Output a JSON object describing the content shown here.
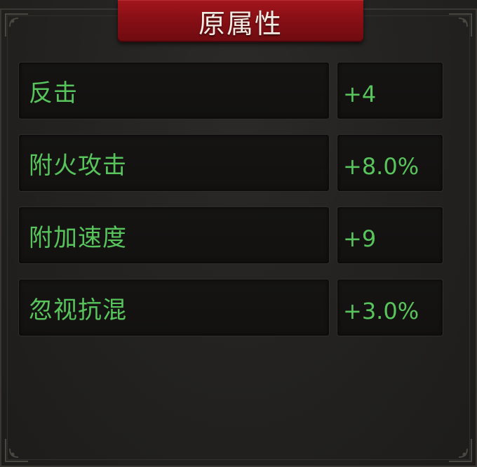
{
  "panel": {
    "title": "原属性",
    "attributes": [
      {
        "name": "反击",
        "value": "+4"
      },
      {
        "name": "附火攻击",
        "value": "+8.0%"
      },
      {
        "name": "附加速度",
        "value": "+9"
      },
      {
        "name": "忽视抗混",
        "value": "+3.0%"
      }
    ]
  },
  "colors": {
    "title_banner": "#8a1016",
    "attribute_text": "#58c45c",
    "cell_background": "#131211",
    "panel_background": "#242321"
  }
}
